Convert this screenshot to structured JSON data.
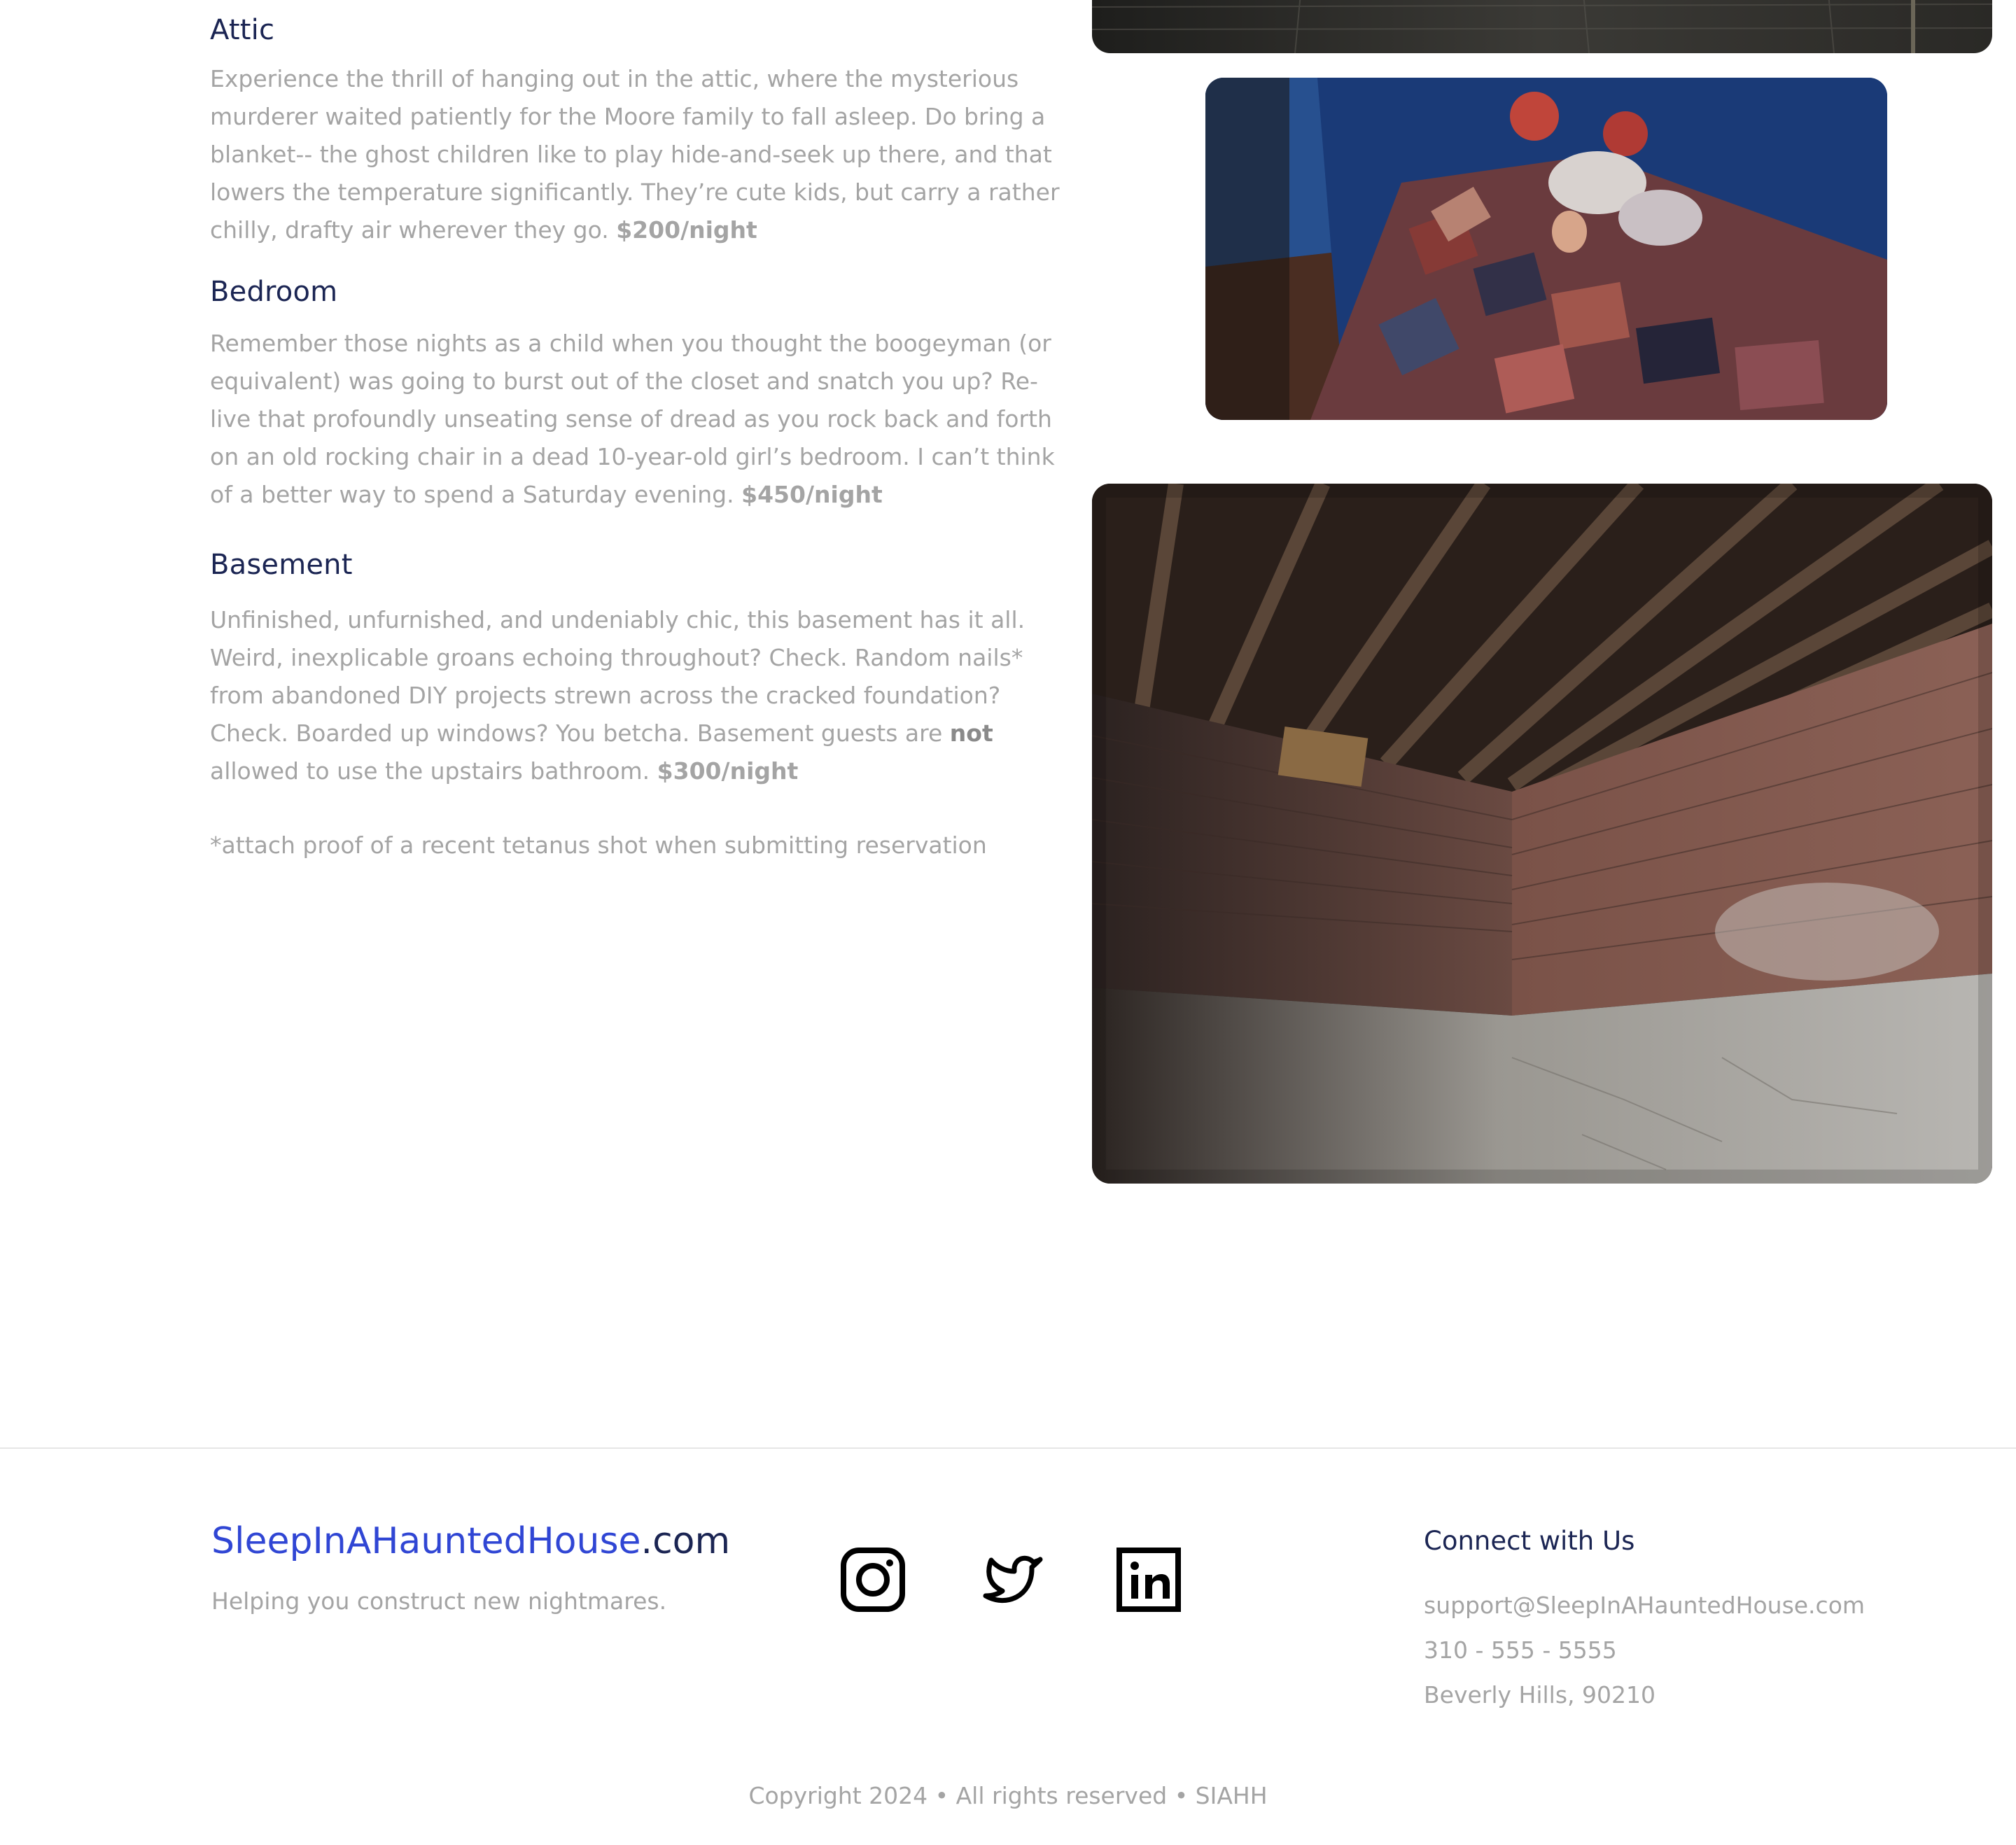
{
  "rooms": [
    {
      "title": "Attic",
      "description": "Experience the thrill of hanging out in the attic, where the mysterious murderer waited patiently for the Moore family to fall asleep. Do bring a blanket-- the ghost children like to play hide-and-seek up there, and that lowers the temperature significantly. They’re cute kids, but carry a rather chilly, drafty air wherever they go.",
      "price": "$200/night"
    },
    {
      "title": "Bedroom",
      "description": "Remember those nights as a child when you thought the boogeyman (or equivalent) was going to burst out of the closet and snatch you up? Re-live that profoundly unseating sense of dread as you rock back and forth on an old rocking chair in a dead 10-year-old girl’s bedroom. I can’t think of a better way to spend a Saturday evening.",
      "price": "$450/night"
    },
    {
      "title": "Basement",
      "description_before": "Unfinished, unfurnished, and undeniably chic, this basement has it all. Weird, inexplicable groans echoing throughout? Check. Random nails* from abandoned DIY projects strewn across the cracked foundation? Check. Boarded up windows? You betcha. Basement guests are",
      "emphasis": "not",
      "description_after": "allowed to use the upstairs bathroom.",
      "price": "$300/night"
    }
  ],
  "note": "*attach proof of a recent tetanus shot when submitting reservation",
  "footer": {
    "brand_main": "SleepInAHauntedHouse",
    "brand_suffix": ".com",
    "tagline": "Helping you construct new nightmares.",
    "social": [
      "instagram-icon",
      "twitter-icon",
      "linkedin-icon"
    ],
    "connect_title": "Connect with Us",
    "email": "support@SleepInAHauntedHouse.com",
    "phone": "310 - 555 - 5555",
    "address": "Beverly Hills, 90210",
    "copyright": "Copyright 2024 • All rights reserved • SIAHH"
  },
  "colors": {
    "heading": "#1b2553",
    "body_text": "#a4a4a4",
    "brand_accent": "#3046d4"
  }
}
